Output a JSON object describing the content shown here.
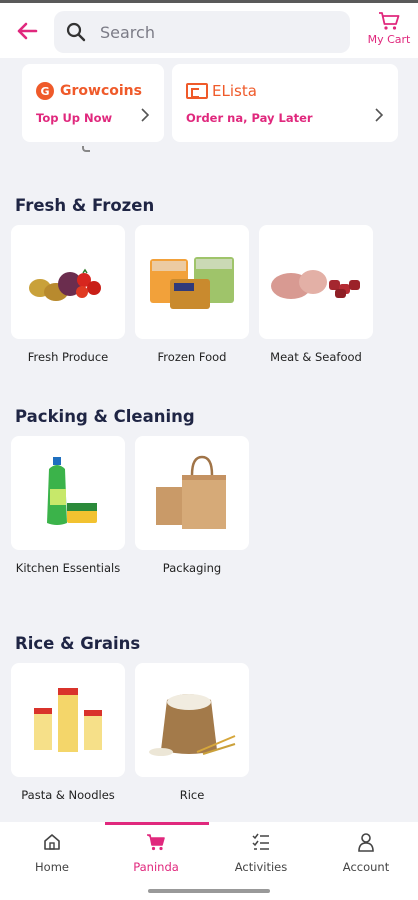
{
  "header": {
    "search": {
      "placeholder": "Search"
    },
    "cart_label": "My Cart"
  },
  "promos": [
    {
      "title": "Growcoins",
      "subtitle": "Top Up Now",
      "badge": "G"
    },
    {
      "title": "ELista",
      "subtitle": "Order na, Pay Later"
    }
  ],
  "sections": [
    {
      "title": "Fresh & Frozen",
      "items": [
        {
          "label": "Fresh Produce"
        },
        {
          "label": "Frozen Food"
        },
        {
          "label": "Meat & Seafood"
        }
      ]
    },
    {
      "title": "Packing & Cleaning",
      "items": [
        {
          "label": "Kitchen Essentials"
        },
        {
          "label": "Packaging"
        }
      ]
    },
    {
      "title": "Rice & Grains",
      "items": [
        {
          "label": "Pasta & Noodles"
        },
        {
          "label": "Rice"
        }
      ]
    }
  ],
  "bottom_nav": [
    {
      "label": "Home",
      "icon": "home-icon"
    },
    {
      "label": "Paninda",
      "icon": "cart-icon",
      "active": true
    },
    {
      "label": "Activities",
      "icon": "checklist-icon"
    },
    {
      "label": "Account",
      "icon": "user-icon"
    }
  ],
  "colors": {
    "accent": "#e0287d",
    "orange": "#ef5a2a",
    "background": "#f1f2f6",
    "heading": "#1f2544"
  }
}
